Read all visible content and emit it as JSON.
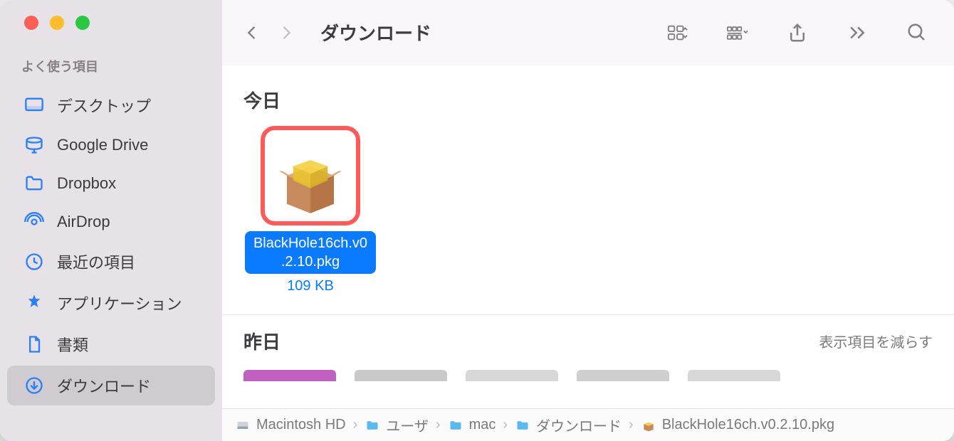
{
  "window": {
    "title": "ダウンロード"
  },
  "sidebar": {
    "section": "よく使う項目",
    "items": [
      {
        "icon": "desktop",
        "label": "デスクトップ"
      },
      {
        "icon": "drive",
        "label": "Google Drive"
      },
      {
        "icon": "folder",
        "label": "Dropbox"
      },
      {
        "icon": "airdrop",
        "label": "AirDrop"
      },
      {
        "icon": "clock",
        "label": "最近の項目"
      },
      {
        "icon": "apps",
        "label": "アプリケーション"
      },
      {
        "icon": "document",
        "label": "書類"
      },
      {
        "icon": "download",
        "label": "ダウンロード",
        "selected": true
      }
    ]
  },
  "toolbar": {
    "view_icon": "grid",
    "group_icon": "group",
    "share_icon": "share",
    "more_icon": "more",
    "search_icon": "search"
  },
  "content": {
    "sections": [
      {
        "header": "今日",
        "files": [
          {
            "name_lines": [
              "BlackHole16ch.v0",
              ".2.10.pkg"
            ],
            "size": "109 KB",
            "kind": "pkg",
            "selected": true,
            "highlighted": true
          }
        ]
      },
      {
        "header": "昨日",
        "show_less_label": "表示項目を減らす",
        "mini_previews": [
          {
            "color": "#c060c0"
          },
          {
            "color": "#c9c9c9"
          },
          {
            "color": "#d8d8d8"
          },
          {
            "color": "#cfcfcf"
          },
          {
            "color": "#d8d8d8"
          }
        ]
      }
    ]
  },
  "pathbar": {
    "segments": [
      {
        "icon": "hdd",
        "label": "Macintosh HD"
      },
      {
        "icon": "folder",
        "label": "ユーザ"
      },
      {
        "icon": "folder",
        "label": "mac"
      },
      {
        "icon": "folder",
        "label": "ダウンロード"
      },
      {
        "icon": "pkg",
        "label": "BlackHole16ch.v0.2.10.pkg"
      }
    ]
  }
}
